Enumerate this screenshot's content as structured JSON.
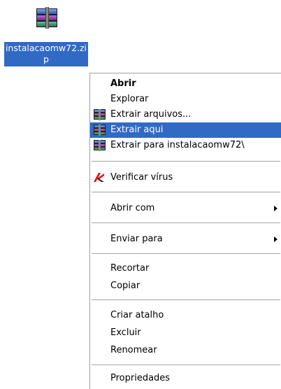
{
  "desktop_icon": {
    "label": "instalacaomw72.zip",
    "label_line1": "instalacaomw72.zi",
    "label_line2": "p",
    "icon": "winrar-archive-icon"
  },
  "context_menu": {
    "items": [
      {
        "label": "Abrir",
        "bold": true
      },
      {
        "label": "Explorar"
      },
      {
        "label": "Extrair arquivos...",
        "icon": "winrar-icon"
      },
      {
        "label": "Extrair aqui",
        "icon": "winrar-icon",
        "highlighted": true
      },
      {
        "label": "Extrair para instalacaomw72\\",
        "icon": "winrar-icon"
      },
      {
        "label": "Verificar vírus",
        "icon": "kaspersky-icon"
      },
      {
        "label": "Abrir com",
        "submenu": true
      },
      {
        "label": "Enviar para",
        "submenu": true
      },
      {
        "label": "Recortar"
      },
      {
        "label": "Copiar"
      },
      {
        "label": "Criar atalho"
      },
      {
        "label": "Excluir"
      },
      {
        "label": "Renomear"
      },
      {
        "label": "Propriedades"
      }
    ]
  },
  "colors": {
    "selection": "#316ac5",
    "separator": "#a7a7a7",
    "border": "#a0a0a0",
    "text": "#000000"
  }
}
